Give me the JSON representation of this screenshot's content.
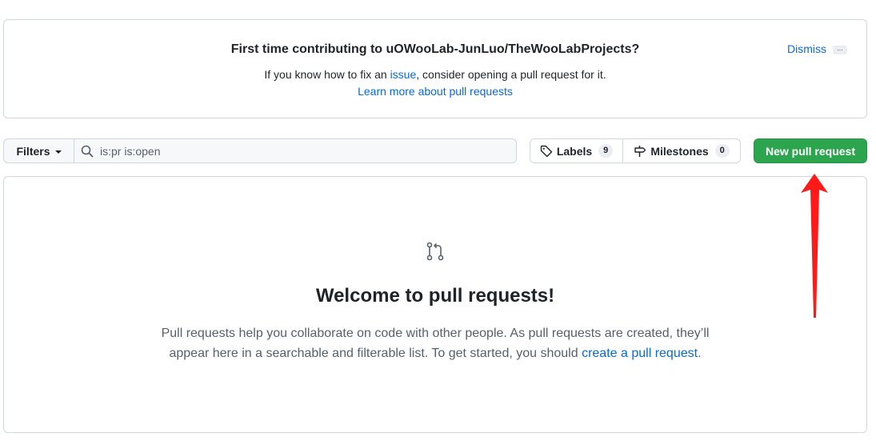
{
  "banner": {
    "title": "First time contributing to uOWooLab-JunLuo/TheWooLabProjects?",
    "line_prefix": "If you know how to fix an ",
    "issue_link": "issue",
    "line_suffix": ", consider opening a pull request for it.",
    "learn_link": "Learn more about pull requests",
    "dismiss": "Dismiss",
    "more": "..."
  },
  "toolbar": {
    "filters_label": "Filters",
    "search_value": "is:pr is:open",
    "labels": {
      "label": "Labels",
      "count": "9"
    },
    "milestones": {
      "label": "Milestones",
      "count": "0"
    },
    "new_pr_label": "New pull request"
  },
  "blankslate": {
    "icon": "git-pull-request-icon",
    "title": "Welcome to pull requests!",
    "text_before": "Pull requests help you collaborate on code with other people. As pull requests are created, they’ll appear here in a searchable and filterable list. To get started, you should ",
    "link": "create a pull request",
    "text_after": "."
  },
  "colors": {
    "accent_link": "#0969da",
    "primary_button": "#2da44e",
    "annotation_arrow": "#ff1a1a"
  }
}
